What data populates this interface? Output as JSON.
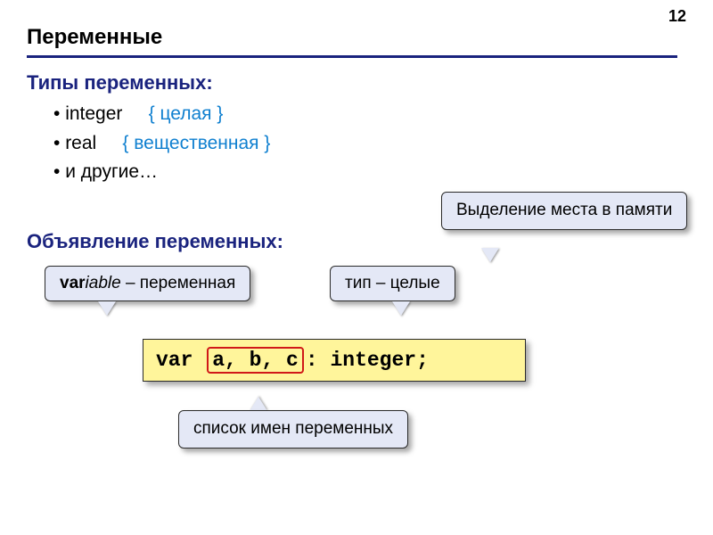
{
  "page_number": "12",
  "title": "Переменные",
  "types": {
    "heading": "Типы переменных:",
    "items": [
      {
        "type": "integer",
        "comment": "{ целая }"
      },
      {
        "type": "real",
        "comment": "{ вещественная }"
      },
      {
        "type": "и другие…",
        "comment": ""
      }
    ]
  },
  "declaration_heading": "Объявление переменных:",
  "callouts": {
    "variable_prefix": "var",
    "variable_suffix": "iable",
    "variable_rest": " – переменная",
    "type": "тип – целые",
    "memory": "Выделение места в памяти",
    "names": "список имен переменных"
  },
  "code": {
    "kw": "var",
    "names": "a, b, c",
    "rest": ": integer;"
  }
}
